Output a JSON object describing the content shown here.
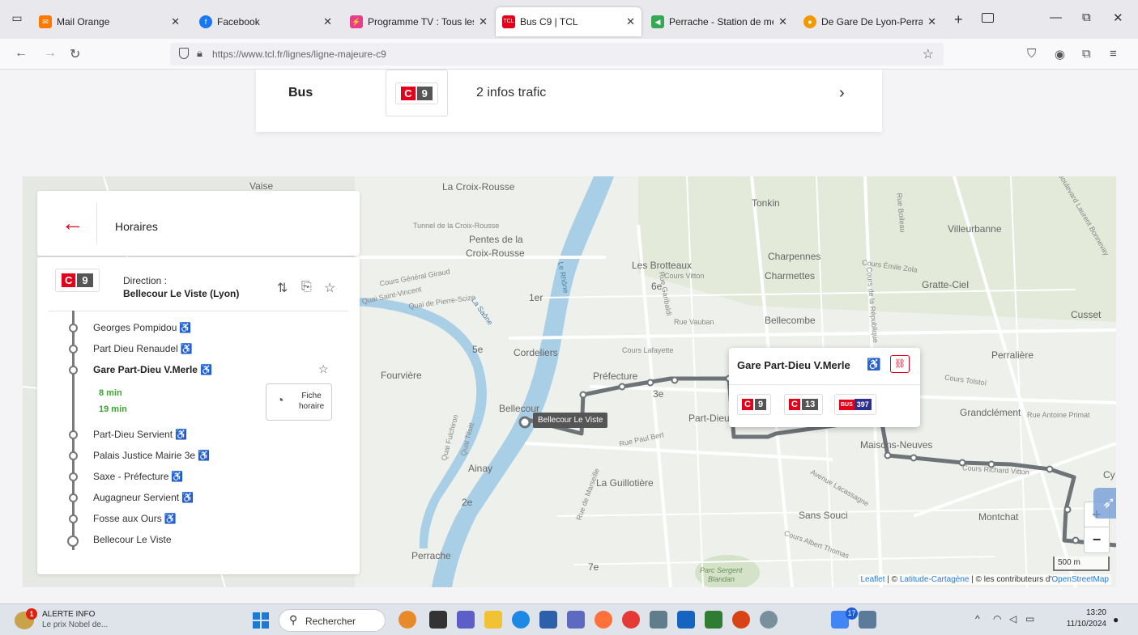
{
  "browser": {
    "tabs": [
      {
        "label": "Mail Orange",
        "icon": "mail-icon",
        "color": "#ff7900"
      },
      {
        "label": "Facebook",
        "icon": "facebook-icon",
        "color": "#1877f2"
      },
      {
        "label": "Programme TV : Tous les prc",
        "icon": "tv-icon",
        "color": "#e63e8a"
      },
      {
        "label": "Bus C9 | TCL",
        "icon": "tcl-icon",
        "color": "#e2001a"
      },
      {
        "label": "Perrache - Station de métro",
        "icon": "map-icon",
        "color": "#34a853"
      },
      {
        "label": "De Gare De Lyon-Perrache à",
        "icon": "pin-icon",
        "color": "#f29900"
      }
    ],
    "url": "https://www.tcl.fr/lignes/ligne-majeure-c9"
  },
  "trafic": {
    "mode": "Bus",
    "line_prefix": "C",
    "line_number": "9",
    "info": "2 infos trafic"
  },
  "panel": {
    "title": "Horaires",
    "line_prefix": "C",
    "line_number": "9",
    "direction_label": "Direction :",
    "direction_value": "Bellecour Le Viste (Lyon)",
    "stops": [
      {
        "name": "Georges Pompidou",
        "accessible": "♿"
      },
      {
        "name": "Part Dieu Renaudel",
        "accessible": "♿"
      },
      {
        "name": "Gare Part-Dieu V.Merle",
        "accessible": "♿"
      },
      {
        "name": "Part-Dieu Servient",
        "accessible": "♿"
      },
      {
        "name": "Palais Justice Mairie 3e",
        "accessible": "♿"
      },
      {
        "name": "Saxe - Préfecture",
        "accessible": "♿"
      },
      {
        "name": "Augagneur Servient",
        "accessible": "♿"
      },
      {
        "name": "Fosse aux Ours",
        "accessible": "♿"
      },
      {
        "name": "Bellecour Le Viste",
        "accessible": ""
      }
    ],
    "times": [
      "8 min",
      "19 min"
    ],
    "fiche_label_1": "Fiche",
    "fiche_label_2": "horaire"
  },
  "map": {
    "labels": {
      "vaise": "Vaise",
      "croix_rousse": "La Croix-Rousse",
      "pentes1": "Pentes de la",
      "pentes2": "Croix-Rousse",
      "tonkin": "Tonkin",
      "villeurbanne": "Villeurbanne",
      "brotteaux": "Les Brotteaux",
      "charpennes": "Charpennes",
      "charmettes": "Charmettes",
      "gratte_ciel": "Gratte-Ciel",
      "sixe": "6e",
      "first": "1er",
      "cusset": "Cusset",
      "bellecombe": "Bellecombe",
      "fifth": "5e",
      "cordeliers": "Cordeliers",
      "perraliere": "Perralière",
      "fourviere": "Fourvière",
      "prefecture": "Préfecture",
      "third": "3e",
      "bellecour": "Bellecour",
      "part_dieu": "Part-Dieu",
      "grandclement": "Grandclément",
      "maisons_neuves": "Maisons-Neuves",
      "ainay": "Ainay",
      "guillotiere": "La Guillotière",
      "second": "2e",
      "sans_souci": "Sans Souci",
      "montchat": "Montchat",
      "perrache": "Perrache",
      "seventh": "7e",
      "parc1": "Parc Sergent",
      "parc2": "Blandan",
      "cy": "Cy",
      "le_rhone": "Le Rhône",
      "la_saone": "La Saône",
      "tunnel": "Tunnel de la Croix-Rousse",
      "cours_general_giraud": "Cours Général Giraud",
      "quai_saint_vincent": "Quai Saint-Vincent",
      "quai_pierre_scize": "Quai de Pierre-Scize",
      "cours_vitton": "Cours Vitton",
      "rue_garibaldi": "Rue Garibaldi",
      "rue_vauban": "Rue Vauban",
      "cours_lafayette": "Cours Lafayette",
      "cours_emile_zola": "Cours Émile Zola",
      "cours_republique": "Cours de la République",
      "cours_tolstoi": "Cours Tolstoï",
      "rue_antoine_primat": "Rue Antoine Primat",
      "rue_paul_bert": "Rue Paul Bert",
      "avenue_lacassagne": "Avenue Lacassagne",
      "richard_vitton": "Cours Richard Vitton",
      "cours_albert_thomas": "Cours Albert Thomas",
      "quai_fulchiron": "Quai Fulchiron",
      "quai_tilsitt": "Quai Tilsitt",
      "rue_marseille": "Rue de Marseille",
      "rue_boileau": "Rue Boileau",
      "bd_laurent_bonnevay": "Boulevard Laurent Bonnevay"
    },
    "tooltip": "Bellecour Le Viste",
    "popup": {
      "stop_name": "Gare Part-Dieu V.Merle",
      "accessible": "♿",
      "lines": [
        {
          "prefix": "C",
          "number": "9"
        },
        {
          "prefix": "C",
          "number": "13"
        }
      ],
      "bus_tag": "BUS",
      "bus_number": "397"
    },
    "zoom_in": "+",
    "zoom_out": "−",
    "scale": "500 m",
    "attribution": {
      "leaflet": "Leaflet",
      "sep1": " | © ",
      "latitude": "Latitude-Cartagène",
      "sep2": " | © les contributeurs d'",
      "osm": "OpenStreetMap"
    }
  },
  "taskbar": {
    "alert_title": "ALERTE INFO",
    "alert_text": "Le prix Nobel de...",
    "alert_count": "1",
    "search_placeholder": "Rechercher",
    "badge_count": "17",
    "time": "13:20",
    "date": "11/10/2024"
  },
  "colors": {
    "tcl_red": "#e2001a",
    "route": "#6d7478",
    "river": "#a8cfe6",
    "park": "#d4e3c8",
    "green_time": "#3aa531"
  }
}
